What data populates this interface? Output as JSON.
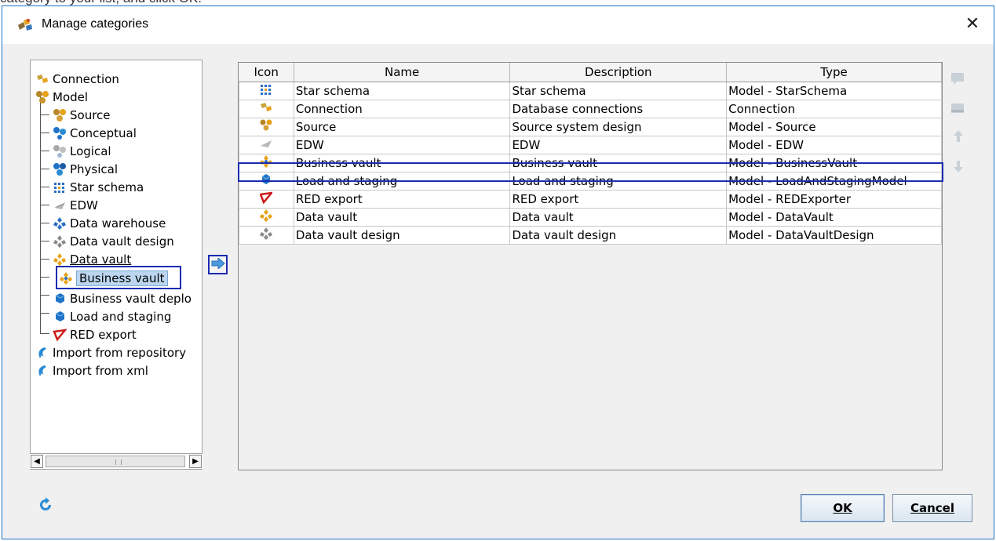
{
  "doc_fragment": "category to your list, and click OK.",
  "dialog": {
    "title": "Manage categories",
    "close_glyph": "✕"
  },
  "tree": {
    "items": [
      {
        "label": "Connection",
        "icon": "connection-icon",
        "level": 0
      },
      {
        "label": "Model",
        "icon": "model-icon",
        "level": 0
      },
      {
        "label": "Source",
        "icon": "source-icon",
        "level": 1
      },
      {
        "label": "Conceptual",
        "icon": "conceptual-icon",
        "level": 1
      },
      {
        "label": "Logical",
        "icon": "logical-icon",
        "level": 1
      },
      {
        "label": "Physical",
        "icon": "physical-icon",
        "level": 1
      },
      {
        "label": "Star schema",
        "icon": "star-schema-icon",
        "level": 1
      },
      {
        "label": "EDW",
        "icon": "edw-icon",
        "level": 1
      },
      {
        "label": "Data warehouse",
        "icon": "data-warehouse-icon",
        "level": 1
      },
      {
        "label": "Data vault design",
        "icon": "data-vault-design-icon",
        "level": 1
      },
      {
        "label": "Data vault",
        "icon": "data-vault-icon",
        "level": 1
      },
      {
        "label": "Business vault",
        "icon": "business-vault-icon",
        "level": 1,
        "selected": true
      },
      {
        "label": "Business vault deplo",
        "icon": "business-vault-deploy-icon",
        "level": 1
      },
      {
        "label": "Load and staging",
        "icon": "load-staging-icon",
        "level": 1
      },
      {
        "label": "RED export",
        "icon": "red-export-icon",
        "level": 1
      },
      {
        "label": "Import from repository",
        "icon": "import-icon",
        "level": 0
      },
      {
        "label": "Import from xml",
        "icon": "import-icon",
        "level": 0
      }
    ]
  },
  "table": {
    "columns": [
      "Icon",
      "Name",
      "Description",
      "Type"
    ],
    "rows": [
      {
        "icon": "star-schema-icon",
        "name": "Star schema",
        "description": "Star schema",
        "type": "Model - StarSchema"
      },
      {
        "icon": "connection-icon",
        "name": "Connection",
        "description": "Database connections",
        "type": "Connection"
      },
      {
        "icon": "source-icon",
        "name": "Source",
        "description": "Source system design",
        "type": "Model - Source"
      },
      {
        "icon": "edw-icon",
        "name": "EDW",
        "description": "EDW",
        "type": "Model - EDW"
      },
      {
        "icon": "business-vault-icon",
        "name": "Business vault",
        "description": "Business vault",
        "type": "Model - BusinessVault",
        "highlighted": true
      },
      {
        "icon": "load-staging-icon",
        "name": "Load and staging",
        "description": "Load and staging",
        "type": "Model - LoadAndStagingModel"
      },
      {
        "icon": "red-export-icon",
        "name": "RED export",
        "description": "RED export",
        "type": "Model - REDExporter"
      },
      {
        "icon": "data-vault-icon",
        "name": "Data vault",
        "description": "Data vault",
        "type": "Model - DataVault"
      },
      {
        "icon": "data-vault-design-icon",
        "name": "Data vault design",
        "description": "Data vault design",
        "type": "Model - DataVaultDesign"
      }
    ]
  },
  "buttons": {
    "ok_label": "OK",
    "cancel_label": "Cancel"
  },
  "colors": {
    "selection_outline": "#1c2bb0",
    "dialog_border": "#1a73c8"
  }
}
